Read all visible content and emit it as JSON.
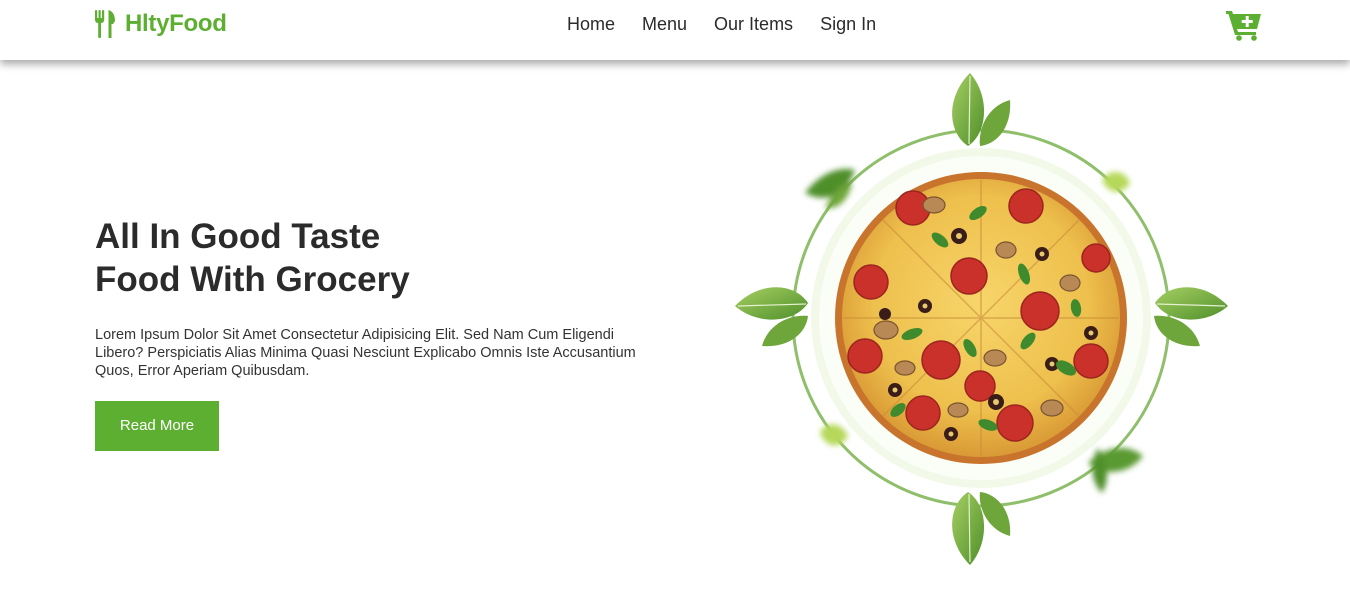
{
  "brand": {
    "name": "HltyFood",
    "icon": "fork-knife-icon",
    "color": "#5daf32"
  },
  "nav": {
    "items": [
      {
        "label": "Home"
      },
      {
        "label": "Menu"
      },
      {
        "label": "Our Items"
      },
      {
        "label": "Sign In"
      }
    ]
  },
  "cart": {
    "icon": "cart-plus-icon"
  },
  "hero": {
    "title_line1": "All In Good Taste",
    "title_line2": "Food With Grocery",
    "description": "Lorem Ipsum Dolor Sit Amet Consectetur Adipisicing Elit. Sed Nam Cum Eligendi Libero? Perspiciatis Alias Minima Quasi Nesciunt Explicabo Omnis Iste Accusantium Quos, Error Aperiam Quibusdam.",
    "button_label": "Read More",
    "image": "pizza-with-basil-leaves-image"
  },
  "colors": {
    "accent": "#5daf32",
    "text": "#2b2b2b",
    "ring": "#8fbf6a"
  }
}
